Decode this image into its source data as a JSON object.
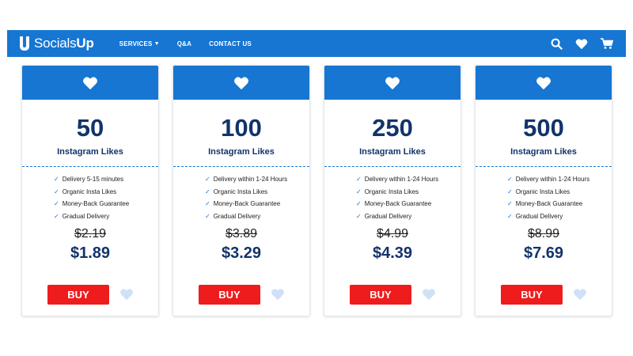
{
  "brand": {
    "name_part1": "Socials",
    "name_part2": "Up",
    "mark": "U"
  },
  "nav": [
    {
      "label": "SERVICES",
      "caret": "▼"
    },
    {
      "label": "Q&A",
      "caret": ""
    },
    {
      "label": "CONTACT US",
      "caret": ""
    }
  ],
  "icons": {
    "search": "search-icon",
    "wishlist": "heart-icon",
    "cart": "cart-icon"
  },
  "colors": {
    "primary": "#1676d2",
    "buy": "#ee1c1c",
    "text_dark": "#12336b",
    "wish_light": "#cfe1f7"
  },
  "check_mark": "✓",
  "packages": [
    {
      "quantity": "50",
      "label": "Instagram Likes",
      "features": [
        "Delivery 5-15 minutes",
        "Organic Insta Likes",
        "Money-Back Guarantee",
        "Gradual Delivery"
      ],
      "old_price": "$2.19",
      "price": "$1.89",
      "buy_label": "BUY"
    },
    {
      "quantity": "100",
      "label": "Instagram Likes",
      "features": [
        "Delivery within 1-24 Hours",
        "Organic Insta Likes",
        "Money-Back Guarantee",
        "Gradual Delivery"
      ],
      "old_price": "$3.89",
      "price": "$3.29",
      "buy_label": "BUY"
    },
    {
      "quantity": "250",
      "label": "Instagram Likes",
      "features": [
        "Delivery within 1-24 Hours",
        "Organic Insta Likes",
        "Money-Back Guarantee",
        "Gradual Delivery"
      ],
      "old_price": "$4.99",
      "price": "$4.39",
      "buy_label": "BUY"
    },
    {
      "quantity": "500",
      "label": "Instagram Likes",
      "features": [
        "Delivery within 1-24 Hours",
        "Organic Insta Likes",
        "Money-Back Guarantee",
        "Gradual Delivery"
      ],
      "old_price": "$8.99",
      "price": "$7.69",
      "buy_label": "BUY"
    }
  ]
}
